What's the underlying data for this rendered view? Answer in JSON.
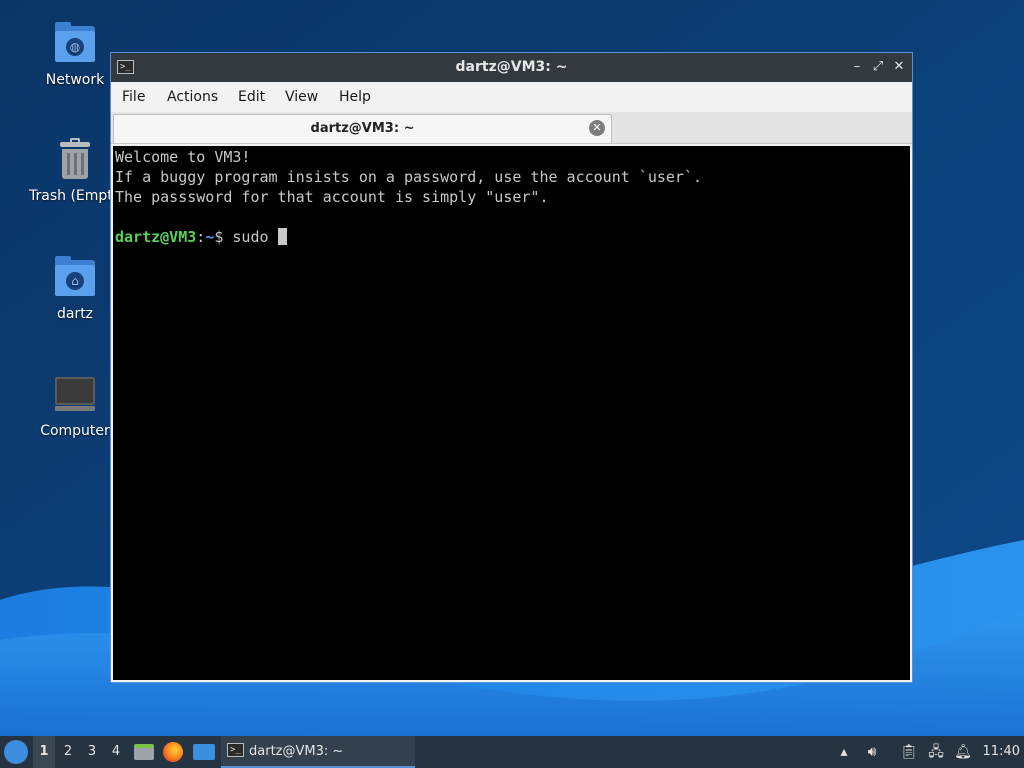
{
  "desktop": {
    "icons": [
      {
        "label": "Network",
        "icon": "network-folder-icon"
      },
      {
        "label": "Trash (Empty)",
        "icon": "trash-icon"
      },
      {
        "label": "dartz",
        "icon": "home-folder-icon"
      },
      {
        "label": "Computer",
        "icon": "computer-icon"
      }
    ]
  },
  "window": {
    "title": "dartz@VM3: ~",
    "controls": {
      "minimize": "–",
      "maximize": "⤢",
      "close": "✕"
    },
    "menu": [
      "File",
      "Actions",
      "Edit",
      "View",
      "Help"
    ],
    "tab": {
      "label": "dartz@VM3: ~",
      "close": "✕"
    },
    "terminal": {
      "lines": [
        "Welcome to VM3!",
        "If a buggy program insists on a password, use the account `user`.",
        "The passsword for that account is simply \"user\".",
        ""
      ],
      "prompt": {
        "user": "dartz@VM3",
        "sep": ":",
        "path": "~",
        "symbol": "$ ",
        "command": "sudo "
      }
    }
  },
  "taskbar": {
    "workspaces": [
      "1",
      "2",
      "3",
      "4"
    ],
    "active_workspace": "1",
    "task_label": "dartz@VM3: ~",
    "clock": "11:40"
  },
  "colors": {
    "wallpaper_dark": "#0c3a6e",
    "wallpaper_light": "#2f8fe8",
    "accent": "#5b8fd6",
    "prompt_user": "#5ad15a",
    "prompt_path": "#6b8cf0"
  }
}
